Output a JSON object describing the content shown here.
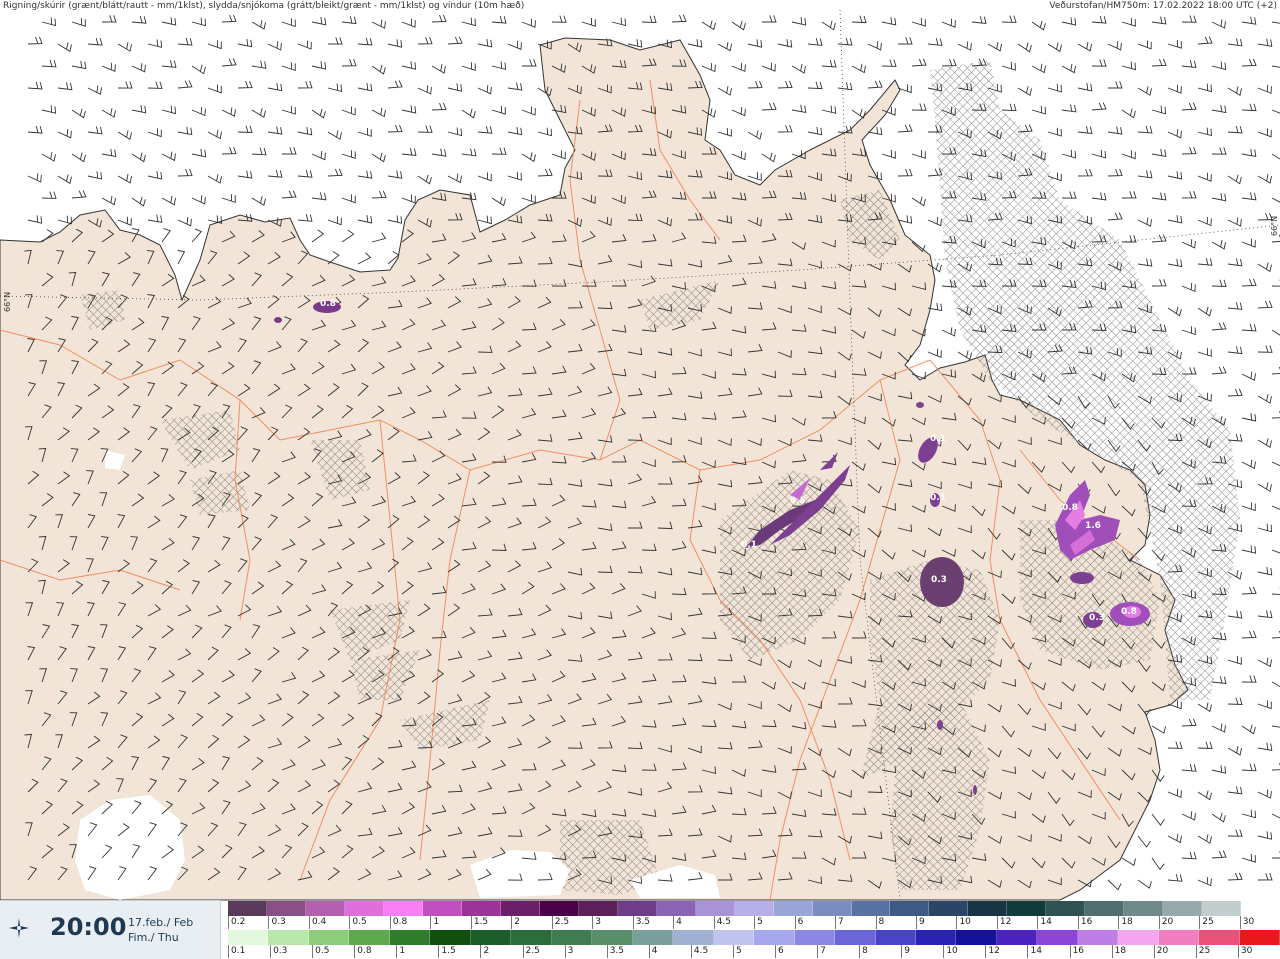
{
  "header": {
    "left_text": "Rigning/skúrir (grænt/blátt/rautt - mm/1klst), slydda/snjókoma (grátt/bleikt/grænt - mm/1klst) og vindur (10m hæð)",
    "right_text": "Veðurstofan/HM750m: 17.02.2022 18:00 UTC (+2)"
  },
  "graticule": {
    "lat_label": "66°N"
  },
  "time_panel": {
    "time": "20:00",
    "date_line1": "17.feb./ Feb",
    "date_line2": "Fim./ Thu",
    "icon": "vedurstofan-logo-icon"
  },
  "precip_labels": [
    {
      "text": "0.8"
    },
    {
      "text": "0.1"
    },
    {
      "text": "0.5"
    },
    {
      "text": "0.1"
    },
    {
      "text": "0.1"
    },
    {
      "text": "0.3"
    },
    {
      "text": "0.8"
    },
    {
      "text": "1.6"
    },
    {
      "text": "0.8"
    },
    {
      "text": "0.3"
    }
  ],
  "legend_snow": {
    "labels": [
      "0.2",
      "0.3",
      "0.4",
      "0.5",
      "0.8",
      "1",
      "1.5",
      "2",
      "2.5",
      "3",
      "3.5",
      "4",
      "4.5",
      "5",
      "6",
      "7",
      "8",
      "9",
      "10",
      "12",
      "14",
      "16",
      "18",
      "20",
      "25",
      "30"
    ],
    "colors": [
      "#5a3a5a",
      "#8a4f87",
      "#b55fb1",
      "#e06fdc",
      "#f97ff5",
      "#c24fbf",
      "#9c3399",
      "#6b1f68",
      "#4a0047",
      "#5c1f5a",
      "#6f3c8a",
      "#8a63b5",
      "#a793d6",
      "#b7b0e8",
      "#9aa5d8",
      "#7a8cc0",
      "#5872a3",
      "#3d5a84",
      "#2a4566",
      "#183545",
      "#0f3b3b",
      "#2e5252",
      "#4f6f6f",
      "#6f8888",
      "#97a9a9",
      "#c2cece",
      "#ffffff"
    ]
  },
  "legend_rain": {
    "labels": [
      "0.1",
      "0.3",
      "0.5",
      "0.8",
      "1",
      "1.5",
      "2",
      "2.5",
      "3",
      "3.5",
      "4",
      "4.5",
      "5",
      "6",
      "7",
      "8",
      "9",
      "10",
      "12",
      "14",
      "16",
      "18",
      "20",
      "25",
      "30"
    ],
    "colors": [
      "#e4f7df",
      "#b9e6aa",
      "#8dcc7a",
      "#5ea84e",
      "#2f7d2a",
      "#114f11",
      "#1b5e2a",
      "#2c6d3c",
      "#3f7c52",
      "#5a8f6b",
      "#7a9f9a",
      "#a0b0d0",
      "#c0c4ee",
      "#a6a8ee",
      "#8b88e4",
      "#6a66d7",
      "#4a43c8",
      "#2a22b5",
      "#15109e",
      "#4c23c2",
      "#8b45d8",
      "#bf7ee7",
      "#f4a6ee",
      "#f07dbd",
      "#ea5079",
      "#e8191c"
    ]
  }
}
